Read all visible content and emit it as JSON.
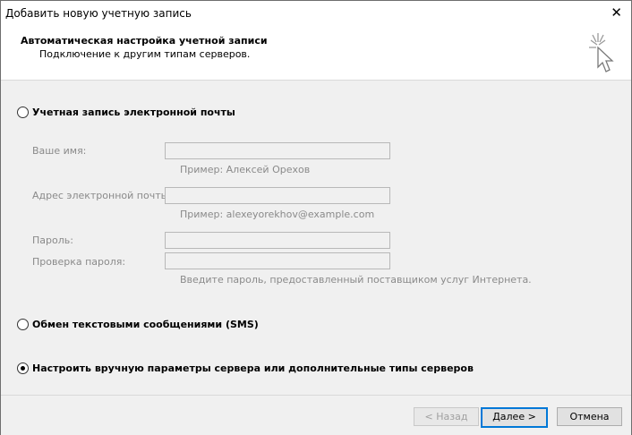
{
  "window": {
    "title": "Добавить новую учетную запись",
    "close_icon": "close-icon"
  },
  "header": {
    "title": "Автоматическая настройка учетной записи",
    "subtitle": "Подключение к другим типам серверов."
  },
  "options": {
    "email_account": "Учетная запись электронной почты",
    "sms": "Обмен текстовыми сообщениями (SMS)",
    "manual": "Настроить вручную параметры сервера или дополнительные типы серверов",
    "selected": "manual"
  },
  "form": {
    "name_label": "Ваше имя:",
    "name_hint": "Пример: Алексей Орехов",
    "email_label": "Адрес электронной почты:",
    "email_hint": "Пример: alexeyorekhov@example.com",
    "password_label": "Пароль:",
    "password_confirm_label": "Проверка пароля:",
    "password_hint": "Введите пароль, предоставленный поставщиком услуг Интернета."
  },
  "buttons": {
    "back": "< Назад",
    "next": "Далее >",
    "cancel": "Отмена"
  }
}
